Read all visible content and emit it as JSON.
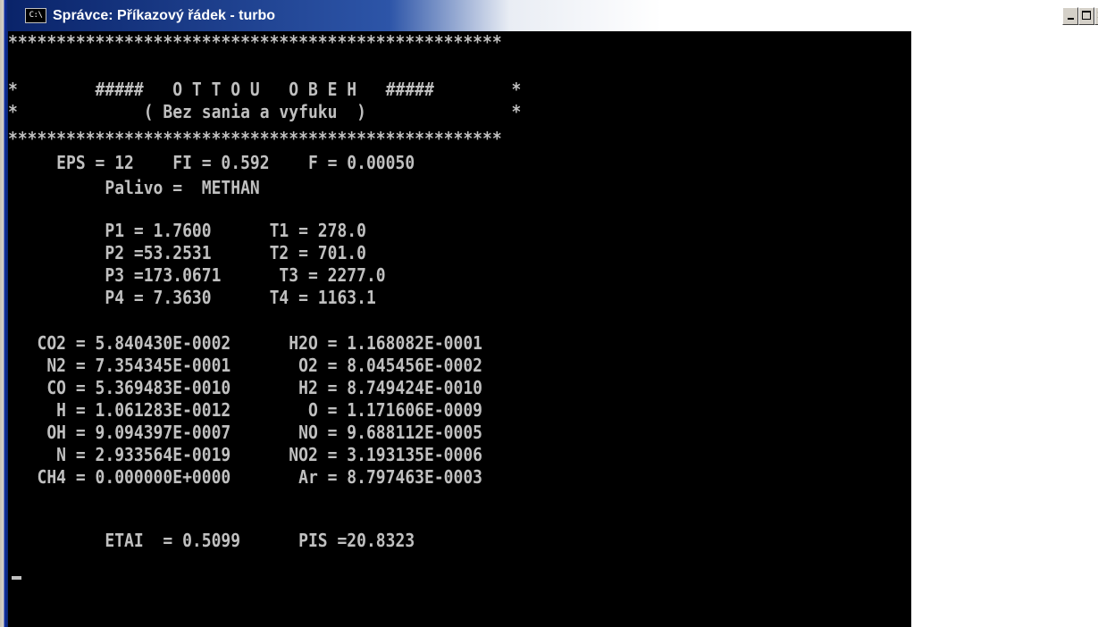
{
  "window": {
    "title": "Správce: Příkazový řádek - turbo",
    "icon_text": "C:\\",
    "controls": {
      "minimize": "minimize-icon",
      "maximize": "maximize-icon",
      "close": "close-icon"
    },
    "colors": {
      "titlebar": "#0a246a",
      "console_bg": "#000000",
      "console_fg": "#c0c0c0"
    }
  },
  "console": {
    "lines": [
      "***************************************************",
      "*        #####   O T T O U   O B E H   #####        *",
      "*             ( Bez sania a vyfuku  )               *",
      "***************************************************",
      "     EPS = 12    FI = 0.592    F = 0.00050",
      "          Palivo =  METHAN",
      "          P1 = 1.7600      T1 = 278.0",
      "          P2 =53.2531      T2 = 701.0",
      "          P3 =173.0671      T3 = 2277.0",
      "          P4 = 7.3630      T4 = 1163.1",
      "   CO2 = 5.840430E-0002      H2O = 1.168082E-0001",
      "    N2 = 7.354345E-0001       O2 = 8.045456E-0002",
      "    CO = 5.369483E-0010       H2 = 8.749424E-0010",
      "     H = 1.061283E-0012        O = 1.171606E-0009",
      "    OH = 9.094397E-0007       NO = 9.688112E-0005",
      "     N = 2.933564E-0019      NO2 = 3.193135E-0006",
      "   CH4 = 0.000000E+0000       Ar = 8.797463E-0003",
      "          ETAI  = 0.5099      PIS =20.8323"
    ]
  }
}
